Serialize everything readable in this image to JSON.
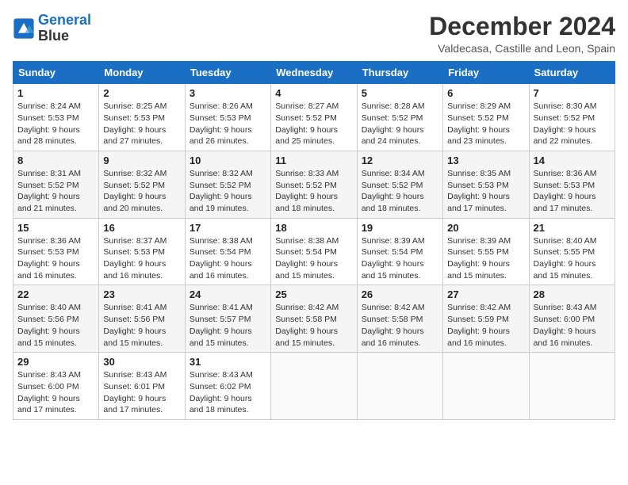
{
  "logo": {
    "general": "General",
    "blue": "Blue"
  },
  "header": {
    "title": "December 2024",
    "subtitle": "Valdecasa, Castille and Leon, Spain"
  },
  "weekdays": [
    "Sunday",
    "Monday",
    "Tuesday",
    "Wednesday",
    "Thursday",
    "Friday",
    "Saturday"
  ],
  "weeks": [
    [
      {
        "day": "1",
        "info": "Sunrise: 8:24 AM\nSunset: 5:53 PM\nDaylight: 9 hours and 28 minutes."
      },
      {
        "day": "2",
        "info": "Sunrise: 8:25 AM\nSunset: 5:53 PM\nDaylight: 9 hours and 27 minutes."
      },
      {
        "day": "3",
        "info": "Sunrise: 8:26 AM\nSunset: 5:53 PM\nDaylight: 9 hours and 26 minutes."
      },
      {
        "day": "4",
        "info": "Sunrise: 8:27 AM\nSunset: 5:52 PM\nDaylight: 9 hours and 25 minutes."
      },
      {
        "day": "5",
        "info": "Sunrise: 8:28 AM\nSunset: 5:52 PM\nDaylight: 9 hours and 24 minutes."
      },
      {
        "day": "6",
        "info": "Sunrise: 8:29 AM\nSunset: 5:52 PM\nDaylight: 9 hours and 23 minutes."
      },
      {
        "day": "7",
        "info": "Sunrise: 8:30 AM\nSunset: 5:52 PM\nDaylight: 9 hours and 22 minutes."
      }
    ],
    [
      {
        "day": "8",
        "info": "Sunrise: 8:31 AM\nSunset: 5:52 PM\nDaylight: 9 hours and 21 minutes."
      },
      {
        "day": "9",
        "info": "Sunrise: 8:32 AM\nSunset: 5:52 PM\nDaylight: 9 hours and 20 minutes."
      },
      {
        "day": "10",
        "info": "Sunrise: 8:32 AM\nSunset: 5:52 PM\nDaylight: 9 hours and 19 minutes."
      },
      {
        "day": "11",
        "info": "Sunrise: 8:33 AM\nSunset: 5:52 PM\nDaylight: 9 hours and 18 minutes."
      },
      {
        "day": "12",
        "info": "Sunrise: 8:34 AM\nSunset: 5:52 PM\nDaylight: 9 hours and 18 minutes."
      },
      {
        "day": "13",
        "info": "Sunrise: 8:35 AM\nSunset: 5:53 PM\nDaylight: 9 hours and 17 minutes."
      },
      {
        "day": "14",
        "info": "Sunrise: 8:36 AM\nSunset: 5:53 PM\nDaylight: 9 hours and 17 minutes."
      }
    ],
    [
      {
        "day": "15",
        "info": "Sunrise: 8:36 AM\nSunset: 5:53 PM\nDaylight: 9 hours and 16 minutes."
      },
      {
        "day": "16",
        "info": "Sunrise: 8:37 AM\nSunset: 5:53 PM\nDaylight: 9 hours and 16 minutes."
      },
      {
        "day": "17",
        "info": "Sunrise: 8:38 AM\nSunset: 5:54 PM\nDaylight: 9 hours and 16 minutes."
      },
      {
        "day": "18",
        "info": "Sunrise: 8:38 AM\nSunset: 5:54 PM\nDaylight: 9 hours and 15 minutes."
      },
      {
        "day": "19",
        "info": "Sunrise: 8:39 AM\nSunset: 5:54 PM\nDaylight: 9 hours and 15 minutes."
      },
      {
        "day": "20",
        "info": "Sunrise: 8:39 AM\nSunset: 5:55 PM\nDaylight: 9 hours and 15 minutes."
      },
      {
        "day": "21",
        "info": "Sunrise: 8:40 AM\nSunset: 5:55 PM\nDaylight: 9 hours and 15 minutes."
      }
    ],
    [
      {
        "day": "22",
        "info": "Sunrise: 8:40 AM\nSunset: 5:56 PM\nDaylight: 9 hours and 15 minutes."
      },
      {
        "day": "23",
        "info": "Sunrise: 8:41 AM\nSunset: 5:56 PM\nDaylight: 9 hours and 15 minutes."
      },
      {
        "day": "24",
        "info": "Sunrise: 8:41 AM\nSunset: 5:57 PM\nDaylight: 9 hours and 15 minutes."
      },
      {
        "day": "25",
        "info": "Sunrise: 8:42 AM\nSunset: 5:58 PM\nDaylight: 9 hours and 15 minutes."
      },
      {
        "day": "26",
        "info": "Sunrise: 8:42 AM\nSunset: 5:58 PM\nDaylight: 9 hours and 16 minutes."
      },
      {
        "day": "27",
        "info": "Sunrise: 8:42 AM\nSunset: 5:59 PM\nDaylight: 9 hours and 16 minutes."
      },
      {
        "day": "28",
        "info": "Sunrise: 8:43 AM\nSunset: 6:00 PM\nDaylight: 9 hours and 16 minutes."
      }
    ],
    [
      {
        "day": "29",
        "info": "Sunrise: 8:43 AM\nSunset: 6:00 PM\nDaylight: 9 hours and 17 minutes."
      },
      {
        "day": "30",
        "info": "Sunrise: 8:43 AM\nSunset: 6:01 PM\nDaylight: 9 hours and 17 minutes."
      },
      {
        "day": "31",
        "info": "Sunrise: 8:43 AM\nSunset: 6:02 PM\nDaylight: 9 hours and 18 minutes."
      },
      null,
      null,
      null,
      null
    ]
  ]
}
